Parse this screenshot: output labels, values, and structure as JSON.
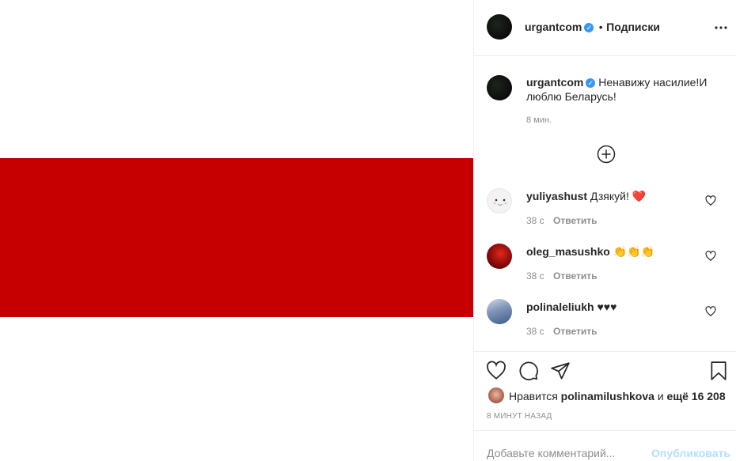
{
  "colors": {
    "flag_red": "#c60000",
    "flag_white": "#ffffff",
    "accent": "#0095f6",
    "publish_disabled": "#b2dffc"
  },
  "post": {
    "author": "urgantcom",
    "follow_label": "Подписки",
    "caption": "Ненавижу насилие!И люблю Беларусь!",
    "caption_line1": "Ненавижу насилие!И",
    "caption_line2": "люблю Беларусь!",
    "caption_time": "8 мин.",
    "more_icon": "ellipsis-icon",
    "load_more_icon": "plus-circle-icon"
  },
  "comments": [
    {
      "user": "yuliyashust",
      "text": "Дзякуй! ❤️",
      "time": "38 с",
      "reply": "Ответить"
    },
    {
      "user": "oleg_masushko",
      "text": "👏👏👏",
      "time": "38 с",
      "reply": "Ответить"
    },
    {
      "user": "polinaleliukh",
      "text": "♥♥♥",
      "time": "38 с",
      "reply": "Ответить"
    }
  ],
  "likes": {
    "prefix": "Нравится",
    "liker": "polinamilushkova",
    "middle": "и",
    "rest": "ещё 16 208"
  },
  "post_time": "8 МИНУТ НАЗАД",
  "comment_box": {
    "placeholder": "Добавьте комментарий...",
    "publish_label": "Опубликовать"
  }
}
